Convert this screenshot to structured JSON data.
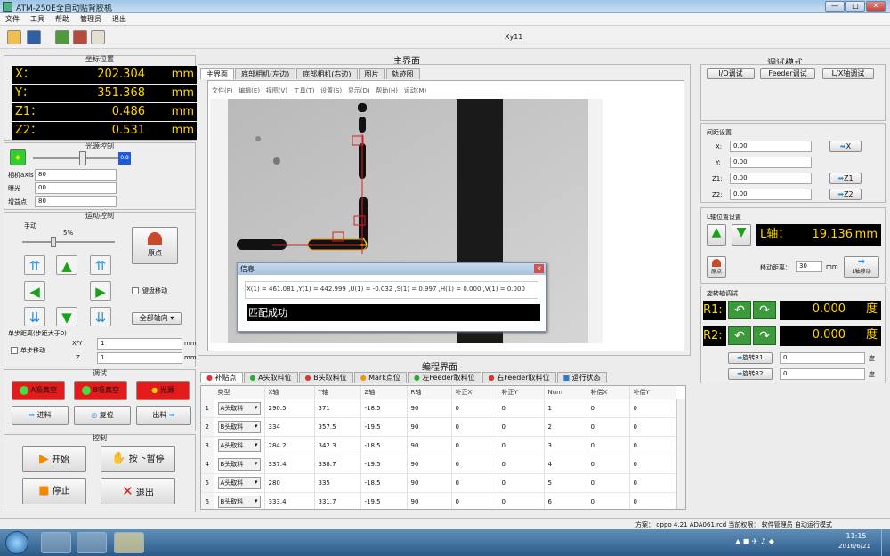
{
  "window": {
    "title": "ATM-250E全自动贴背胶机",
    "minimize": "—",
    "maximize": "□",
    "close": "✕"
  },
  "menu": [
    "文件",
    "工具",
    "帮助",
    "管理员",
    "退出"
  ],
  "toolbar": {
    "center_text": "Xy11"
  },
  "coords": {
    "title": "坐标位置",
    "rows": [
      {
        "axis": "X：",
        "value": "202.304",
        "unit": "mm"
      },
      {
        "axis": "Y：",
        "value": "351.368",
        "unit": "mm"
      },
      {
        "axis": "Z1：",
        "value": "0.486",
        "unit": "mm"
      },
      {
        "axis": "Z2：",
        "value": "0.531",
        "unit": "mm"
      }
    ]
  },
  "light": {
    "title": "光源控制",
    "value": "0.8",
    "fields": [
      {
        "label": "相机aXis",
        "value": "80"
      },
      {
        "label": "曝光",
        "value": "00"
      },
      {
        "label": "增益点",
        "value": "80"
      }
    ]
  },
  "motion": {
    "title": "运动控制",
    "manual_label": "手动",
    "speed_pct": "5%",
    "home_label": "原点",
    "keyboard_move": "键盘移动",
    "all_axes": "全部轴向",
    "step_label": "单步距离(步距大于0)",
    "single_step": "单步移动",
    "xy_label": "X/Y",
    "z_label": "Z",
    "xy_value": "1",
    "z_value": "1",
    "unit": "mm"
  },
  "debug": {
    "title": "调试",
    "a_adsorb": "A吸真空",
    "b_adsorb": "B吸真空",
    "light_btn": "光源",
    "in_label": "进料",
    "reset_label": "复位",
    "out_label": "出料"
  },
  "control": {
    "title": "控制",
    "start": "开始",
    "pause": "按下暂停",
    "stop": "停止",
    "exit": "退出"
  },
  "main": {
    "title": "主界面",
    "tabs": [
      "主界面",
      "底部相机(左边)",
      "底部相机(右边)",
      "图片",
      "轨迹图"
    ],
    "inner_menu": [
      "文件(F)",
      "编辑(E)",
      "视图(V)",
      "工具(T)",
      "设置(S)",
      "显示(D)",
      "帮助(H)",
      "运动(M)"
    ]
  },
  "dialog": {
    "title": "信息",
    "message": "X(1) = 461.081 ,Y(1) = 442.999 ,U(1) = -0.032 ,S(1) = 0.997 ,H(1) = 0.000 ,V(1) = 0.000",
    "result": "匹配成功"
  },
  "program": {
    "title": "编程界面",
    "tabs": [
      "补贴点",
      "A头取料位",
      "B头取料位",
      "Mark点位",
      "左Feeder取料位",
      "右Feeder取料位",
      "运行状态"
    ],
    "columns": [
      "类型",
      "X轴",
      "Y轴",
      "Z轴",
      "R轴",
      "补正X",
      "补正Y",
      "Num",
      "补偿X",
      "补偿Y"
    ],
    "rows": [
      [
        "1",
        "A头取料",
        "290.5",
        "371",
        "-18.5",
        "90",
        "0",
        "0",
        "1",
        "0",
        "0"
      ],
      [
        "2",
        "B头取料",
        "334",
        "357.5",
        "-19.5",
        "90",
        "0",
        "0",
        "2",
        "0",
        "0"
      ],
      [
        "3",
        "A头取料",
        "284.2",
        "342.3",
        "-18.5",
        "90",
        "0",
        "0",
        "3",
        "0",
        "0"
      ],
      [
        "4",
        "B头取料",
        "337.4",
        "338.7",
        "-19.5",
        "90",
        "0",
        "0",
        "4",
        "0",
        "0"
      ],
      [
        "5",
        "A头取料",
        "280",
        "335",
        "-18.5",
        "90",
        "0",
        "0",
        "5",
        "0",
        "0"
      ],
      [
        "6",
        "B头取料",
        "333.4",
        "331.7",
        "-19.5",
        "90",
        "0",
        "0",
        "6",
        "0",
        "0"
      ]
    ]
  },
  "test": {
    "title": "调试模式",
    "buttons": [
      "I/O调试",
      "Feeder调试",
      "L/X轴调试"
    ],
    "spacing_title": "间距设置",
    "spacing": [
      {
        "label": "X:",
        "value": "0.00",
        "btn": "X"
      },
      {
        "label": "Y:",
        "value": "0.00",
        "btn": ""
      },
      {
        "label": "Z1:",
        "value": "0.00",
        "btn": "Z1"
      },
      {
        "label": "Z2:",
        "value": "0.00",
        "btn": "Z2"
      }
    ],
    "l_title": "L轴位置设置",
    "l_axis": "L轴：",
    "l_value": "19.136",
    "l_unit": "mm",
    "origin": "原点",
    "shift_label": "移动距离：",
    "shift_value": "30",
    "shift_unit": "mm",
    "l_move": "L轴移动",
    "rot_title": "旋转轴调试",
    "r1": "R1:",
    "r1_value": "0.000",
    "r2": "R2:",
    "r2_value": "0.000",
    "deg": "度",
    "rot_btn1": "旋转R1",
    "rot_btn2": "旋转R2",
    "rot_in1": "0",
    "rot_in2": "0"
  },
  "status": {
    "text": "方案： oppo 4.21 ADA061.rcd 当前权限： 软件管理员 自动运行模式"
  },
  "taskbar": {
    "time": "11:15",
    "date": "2016/6/21"
  }
}
